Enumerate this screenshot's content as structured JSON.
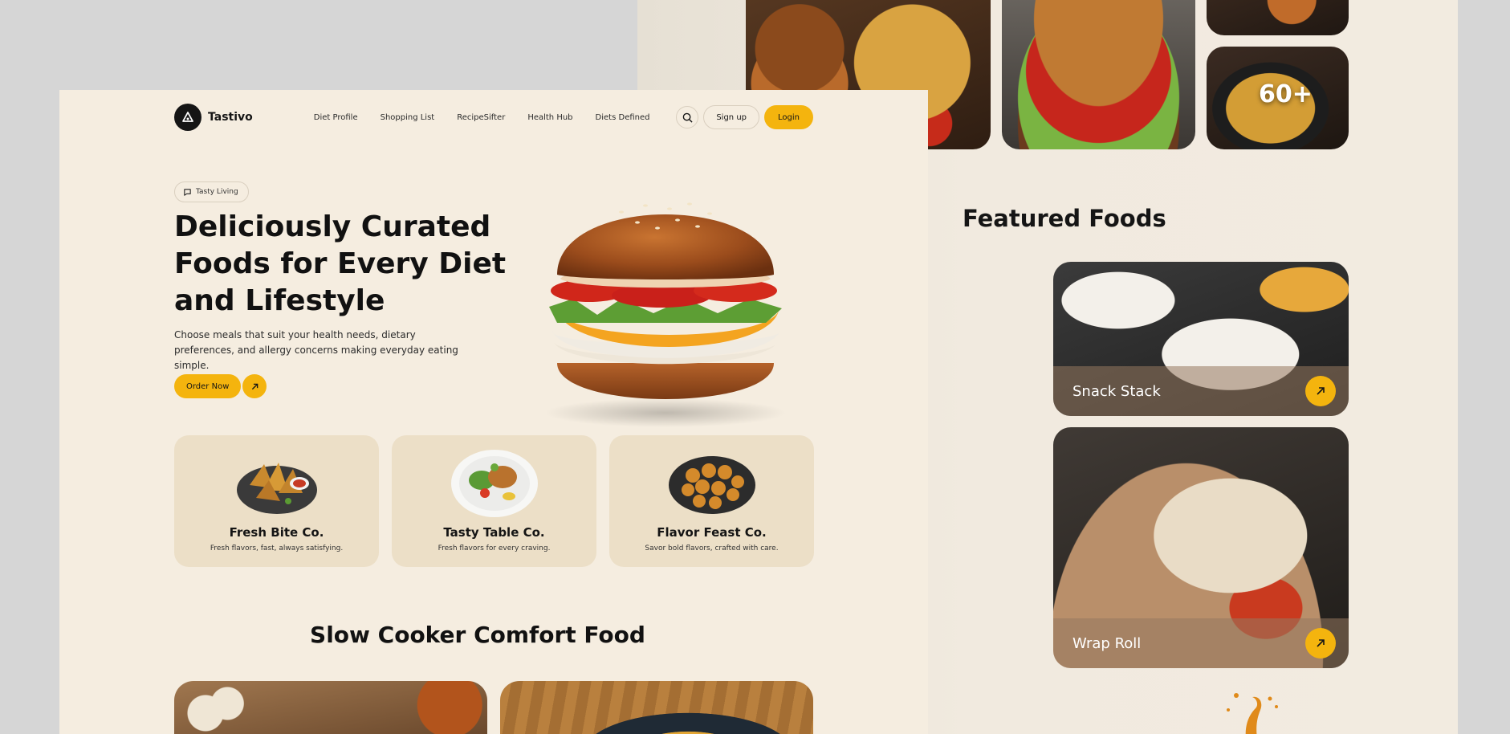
{
  "brand": {
    "name": "Tastivo"
  },
  "nav": {
    "links": [
      "Diet Profile",
      "Shopping List",
      "RecipeSifter",
      "Health Hub",
      "Diets Defined"
    ],
    "signup_label": "Sign up",
    "login_label": "Login"
  },
  "hero": {
    "badge": "Tasty Living",
    "title": "Deliciously Curated Foods for Every Diet and Lifestyle",
    "description": "Choose meals that suit your health needs, dietary preferences, and allergy concerns making everyday eating simple.",
    "cta_label": "Order Now"
  },
  "cards": [
    {
      "title": "Fresh Bite Co.",
      "subtitle": "Fresh flavors, fast, always satisfying."
    },
    {
      "title": "Tasty Table Co.",
      "subtitle": "Fresh flavors for every craving."
    },
    {
      "title": "Flavor Feast Co.",
      "subtitle": "Savor bold flavors, crafted with care."
    }
  ],
  "slow_cooker": {
    "title": "Slow Cooker Comfort Food"
  },
  "gallery": {
    "count_label": "60+"
  },
  "featured": {
    "title": "Featured Foods",
    "items": [
      "Snack Stack",
      "Wrap Roll"
    ]
  },
  "colors": {
    "accent": "#f4b40e",
    "page_bg": "#f5ede0",
    "card_bg": "#ecdfc7",
    "text": "#151515"
  }
}
